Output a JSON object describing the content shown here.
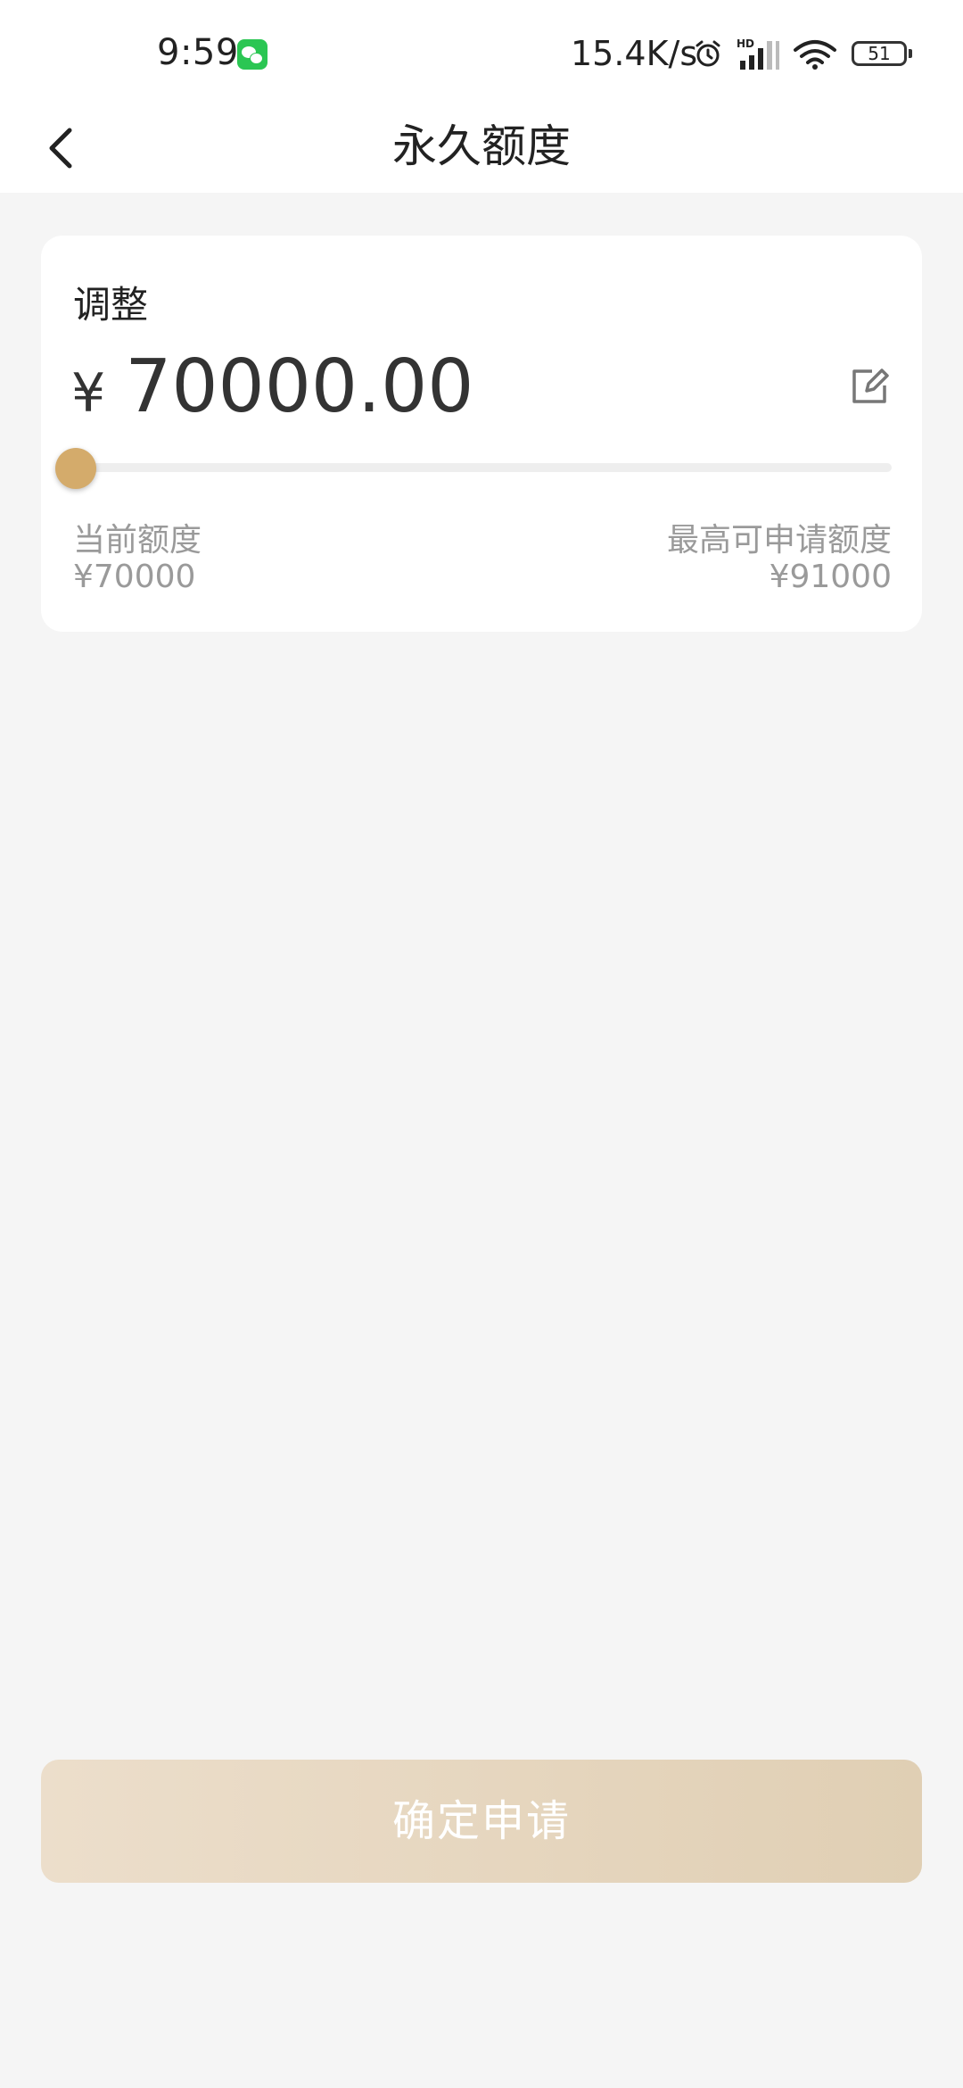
{
  "status_bar": {
    "time": "9:59",
    "network_speed": "15.4K/s",
    "battery_level": "51",
    "signal_badge": "HD"
  },
  "header": {
    "title": "永久额度"
  },
  "card": {
    "label": "调整",
    "currency_symbol": "¥",
    "amount": "70000.00",
    "slider": {
      "min": 70000,
      "max": 91000,
      "value": 70000,
      "fraction": 0.0
    },
    "min_label": "当前额度",
    "min_value": "¥70000",
    "max_label": "最高可申请额度",
    "max_value": "¥91000"
  },
  "submit_button": {
    "label": "确定申请",
    "enabled": false
  },
  "colors": {
    "accent": "#d4ab6b",
    "button_bg": "#e8d9c4",
    "page_bg": "#f5f5f5"
  },
  "icons": {
    "back": "chevron-left-icon",
    "edit": "edit-icon",
    "wechat": "wechat-icon",
    "alarm": "alarm-icon",
    "signal": "signal-icon",
    "wifi": "wifi-icon",
    "battery": "battery-icon"
  }
}
